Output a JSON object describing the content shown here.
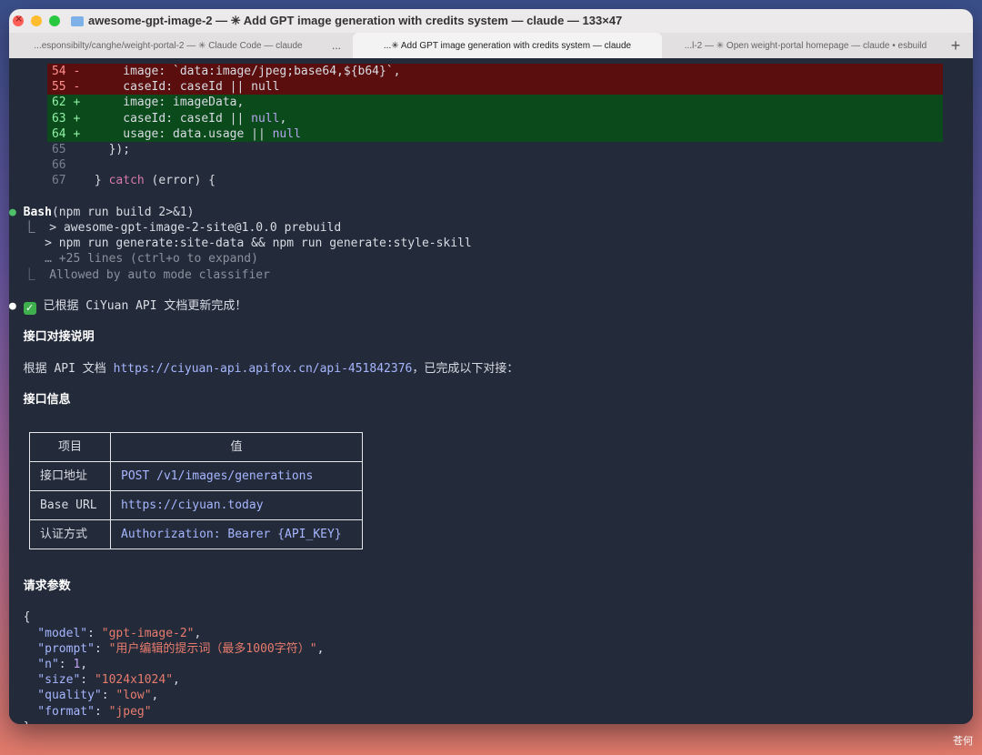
{
  "window": {
    "title": "awesome-gpt-image-2 — ✳ Add GPT image generation with credits system — claude — 133×47"
  },
  "tabs": {
    "tab1": "...esponsibilty/canghe/weight-portal-2 — ✳ Claude Code — claude",
    "more": "...",
    "active": "...✳ Add GPT image generation with credits system — claude",
    "tab3": "...l-2 — ✳ Open weight-portal homepage — claude • esbuild",
    "plus": "+"
  },
  "diff": {
    "l54": {
      "num": "54",
      "sign": "-",
      "code": "      image: `data:image/jpeg;base64,${b64}`,"
    },
    "l55": {
      "num": "55",
      "sign": "-",
      "code": "      caseId: caseId || null"
    },
    "l62": {
      "num": "62",
      "sign": "+",
      "code": "      image: imageData,"
    },
    "l63": {
      "num": "63",
      "sign": "+",
      "code_a": "      caseId: caseId || ",
      "code_b": "null",
      "code_c": ","
    },
    "l64": {
      "num": "64",
      "sign": "+",
      "code_a": "      usage: data.usage || ",
      "code_b": "null"
    },
    "l65": {
      "num": "65",
      "code": "    });"
    },
    "l66": {
      "num": "66",
      "code": ""
    },
    "l67": {
      "num": "67",
      "code_a": "  } ",
      "code_b": "catch",
      "code_c": " (error) {"
    }
  },
  "bash": {
    "bullet": "●",
    "tool": "Bash",
    "command": "(npm run build 2>&1)",
    "out1": "  ⎿  > awesome-gpt-image-2-site@1.0.0 prebuild",
    "out2": "     > npm run generate:site-data && npm run generate:style-skill",
    "out3": "     … +25 lines (ctrl+o to expand)",
    "out4": "  ⎿  Allowed by auto mode classifier"
  },
  "summary": {
    "bullet": "●",
    "check": "✓",
    "text": " 已根据 CiYuan API 文档更新完成！",
    "heading1": "接口对接说明",
    "desc_a": "根据 API 文档 ",
    "desc_link": "https://ciyuan-api.apifox.cn/api-451842376",
    "desc_b": "，已完成以下对接：",
    "heading2": "接口信息",
    "heading3": "请求参数"
  },
  "table": {
    "headers": [
      "项目",
      "值"
    ],
    "rows": [
      [
        "接口地址",
        "POST /v1/images/generations"
      ],
      [
        "Base URL",
        "https://ciyuan.today"
      ],
      [
        "认证方式",
        "Authorization: Bearer {API_KEY}"
      ]
    ]
  },
  "json_block": {
    "open": "{",
    "model_key": "  \"model\"",
    "model_val": "\"gpt-image-2\"",
    "prompt_key": "  \"prompt\"",
    "prompt_val": "\"用户编辑的提示词（最多1000字符）\"",
    "n_key": "  \"n\"",
    "n_val": "1",
    "size_key": "  \"size\"",
    "size_val": "\"1024x1024\"",
    "quality_key": "  \"quality\"",
    "quality_val": "\"low\"",
    "format_key": "  \"format\"",
    "format_val": "\"jpeg\"",
    "close": "}"
  },
  "watermark": "苍何"
}
